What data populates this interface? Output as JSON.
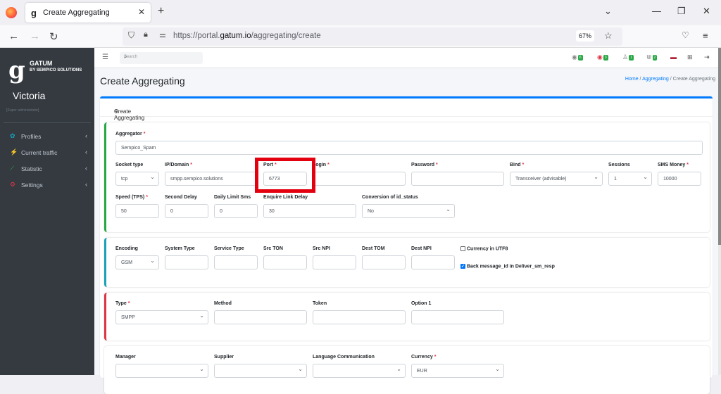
{
  "browser": {
    "tab_title": "Create Aggregating",
    "url_prefix": "https://portal.",
    "url_domain": "gatum.io",
    "url_path": "/aggregating/create",
    "zoom": "67%"
  },
  "sidebar": {
    "brand": "GATUM",
    "brand_sub": "BY SEMPICO SOLUTIONS",
    "user": "Victoria",
    "role": "[Super administrator]",
    "items": [
      {
        "label": "Profiles",
        "icon": "profiles-icon",
        "color": "#17a2b8"
      },
      {
        "label": "Current traffic",
        "icon": "traffic-icon",
        "color": "#007bff"
      },
      {
        "label": "Statistic",
        "icon": "statistic-icon",
        "color": "#28a745"
      },
      {
        "label": "Settings",
        "icon": "settings-icon",
        "color": "#dc3545"
      }
    ]
  },
  "topnav": {
    "search_placeholder": "Search",
    "badges": [
      "6",
      "3",
      "1",
      "2"
    ]
  },
  "page": {
    "title": "Create Aggregating",
    "breadcrumb": {
      "home": "Home",
      "section": "Aggregating",
      "current": "Create Aggregating"
    },
    "card_title": "Create Aggregating"
  },
  "form": {
    "aggregator": {
      "label": "Aggregator",
      "value": "Sempico_Spam"
    },
    "socket_type": {
      "label": "Socket type",
      "value": "tcp"
    },
    "ip_domain": {
      "label": "IP/Domain",
      "value": "smpp.sempico.solutions"
    },
    "port": {
      "label": "Port",
      "value": "6773"
    },
    "login": {
      "label": "Login",
      "value": ""
    },
    "password": {
      "label": "Password",
      "value": ""
    },
    "bind": {
      "label": "Bind",
      "value": "Transceiver (advisable)"
    },
    "sessions": {
      "label": "Sessions",
      "value": "1"
    },
    "sms_money": {
      "label": "SMS Money",
      "value": "10000"
    },
    "speed": {
      "label": "Speed (TPS)",
      "value": "50"
    },
    "second_delay": {
      "label": "Second Delay",
      "value": "0"
    },
    "daily_limit": {
      "label": "Daily Limit Sms",
      "value": "0"
    },
    "enquire_link": {
      "label": "Enquire Link Delay",
      "value": "30"
    },
    "conversion": {
      "label": "Conversion of id_status",
      "value": "No"
    },
    "encoding": {
      "label": "Encoding",
      "value": "GSM"
    },
    "system_type": {
      "label": "System Type",
      "value": ""
    },
    "service_type": {
      "label": "Service Type",
      "value": ""
    },
    "src_ton": {
      "label": "Src TON",
      "value": ""
    },
    "src_npi": {
      "label": "Src NPI",
      "value": ""
    },
    "dest_tom": {
      "label": "Dest TOM",
      "value": ""
    },
    "dest_npi": {
      "label": "Dest NPI",
      "value": ""
    },
    "currency_utf8": {
      "label": "Currency in UTF8",
      "checked": false
    },
    "back_msg_id": {
      "label": "Back message_id in Deliver_sm_resp",
      "checked": true
    },
    "type": {
      "label": "Type",
      "value": "SMPP"
    },
    "method": {
      "label": "Method",
      "value": ""
    },
    "token": {
      "label": "Token",
      "value": ""
    },
    "option1": {
      "label": "Option 1",
      "value": ""
    },
    "manager": {
      "label": "Manager",
      "value": ""
    },
    "supplier": {
      "label": "Supplier",
      "value": ""
    },
    "language": {
      "label": "Language Communication",
      "value": ""
    },
    "currency": {
      "label": "Currency",
      "value": "EUR"
    }
  },
  "colors": {
    "accent": "#007bff",
    "highlight": "#e3000f",
    "sec1": "#28a745",
    "sec2": "#17a2b8",
    "sec3": "#dc3545"
  }
}
